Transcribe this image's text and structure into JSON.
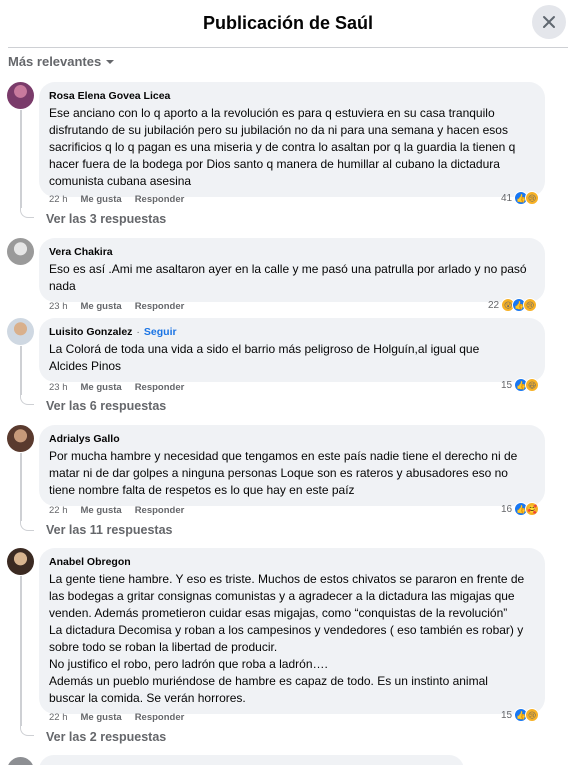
{
  "header": {
    "title": "Publicación de Saúl"
  },
  "sort": {
    "label": "Más relevantes"
  },
  "comments": [
    {
      "author": "Rosa Elena Govea Licea",
      "text": "Ese anciano con lo q aporto a la revolución es para q estuviera en su casa tranquilo\ndisfrutando de su jubilación pero su jubilación no da ni para una semana y hacen esos\nsacrificios q lo q pagan es una miseria y de contra lo asaltan por q la guardia la tienen q\nhacer fuera de la bodega por Dios santo q manera de humillar al cubano la dictadura\ncomunista cubana asesina",
      "time": "22 h",
      "like": "Me gusta",
      "reply": "Responder",
      "count": "41",
      "replies": "Ver las 3 respuestas"
    },
    {
      "author": "Vera Chakira",
      "text": "Eso es así .Ami me asaltaron ayer en la calle y me pasó una patrulla por arlado y no pasó\nnada",
      "time": "23 h",
      "like": "Me gusta",
      "reply": "Responder",
      "count": "22"
    },
    {
      "author": "Luisito Gonzalez",
      "follow": "Seguir",
      "dot": "·",
      "text": "La Colorá de toda una vida a sido el barrio más peligroso de Holguín,al igual que\nAlcides Pinos",
      "time": "23 h",
      "like": "Me gusta",
      "reply": "Responder",
      "count": "15",
      "replies": "Ver las 6 respuestas"
    },
    {
      "author": "Adrialys Gallo",
      "text": "Por mucha hambre y necesidad que tengamos en este país nadie tiene el derecho ni de\nmatar ni de dar golpes a ninguna personas Loque son es rateros y abusadores eso no\ntiene nombre falta de respetos es lo que hay en este paíz",
      "time": "22 h",
      "like": "Me gusta",
      "reply": "Responder",
      "count": "16",
      "replies": "Ver las 11 respuestas"
    },
    {
      "author": "Anabel Obregon",
      "text": "La gente tiene hambre. Y eso es triste. Muchos de estos chivatos se pararon en frente de\nlas bodegas a gritar consignas comunistas y a agradecer a la dictadura las migajas que\nvenden. Además prometieron cuidar esas migajas, como “conquistas de la revolución”\nLa dictadura Decomisa y roban a los campesinos y vendedores ( eso también es robar) y\nsobre todo se roban la libertad de producir.\nNo justifico el robo, pero ladrón que roba a ladrón….\nAdemás un pueblo muriéndose de hambre es capaz de todo. Es un instinto animal\nbuscar la comida. Se verán horrores.",
      "time": "22 h",
      "like": "Me gusta",
      "reply": "Responder",
      "count": "15",
      "replies": "Ver las 2 respuestas"
    }
  ],
  "icons": {
    "close": "close-icon",
    "sort": "chevron-down-icon",
    "like": "like-reaction-icon",
    "sad": "sad-reaction-icon",
    "wow": "wow-reaction-icon",
    "haha": "haha-reaction-icon",
    "care": "care-reaction-icon"
  },
  "colors": {
    "accent": "#1b74e4",
    "bubble": "#f0f2f5",
    "muted": "#65676b",
    "like": "#1877f2"
  }
}
